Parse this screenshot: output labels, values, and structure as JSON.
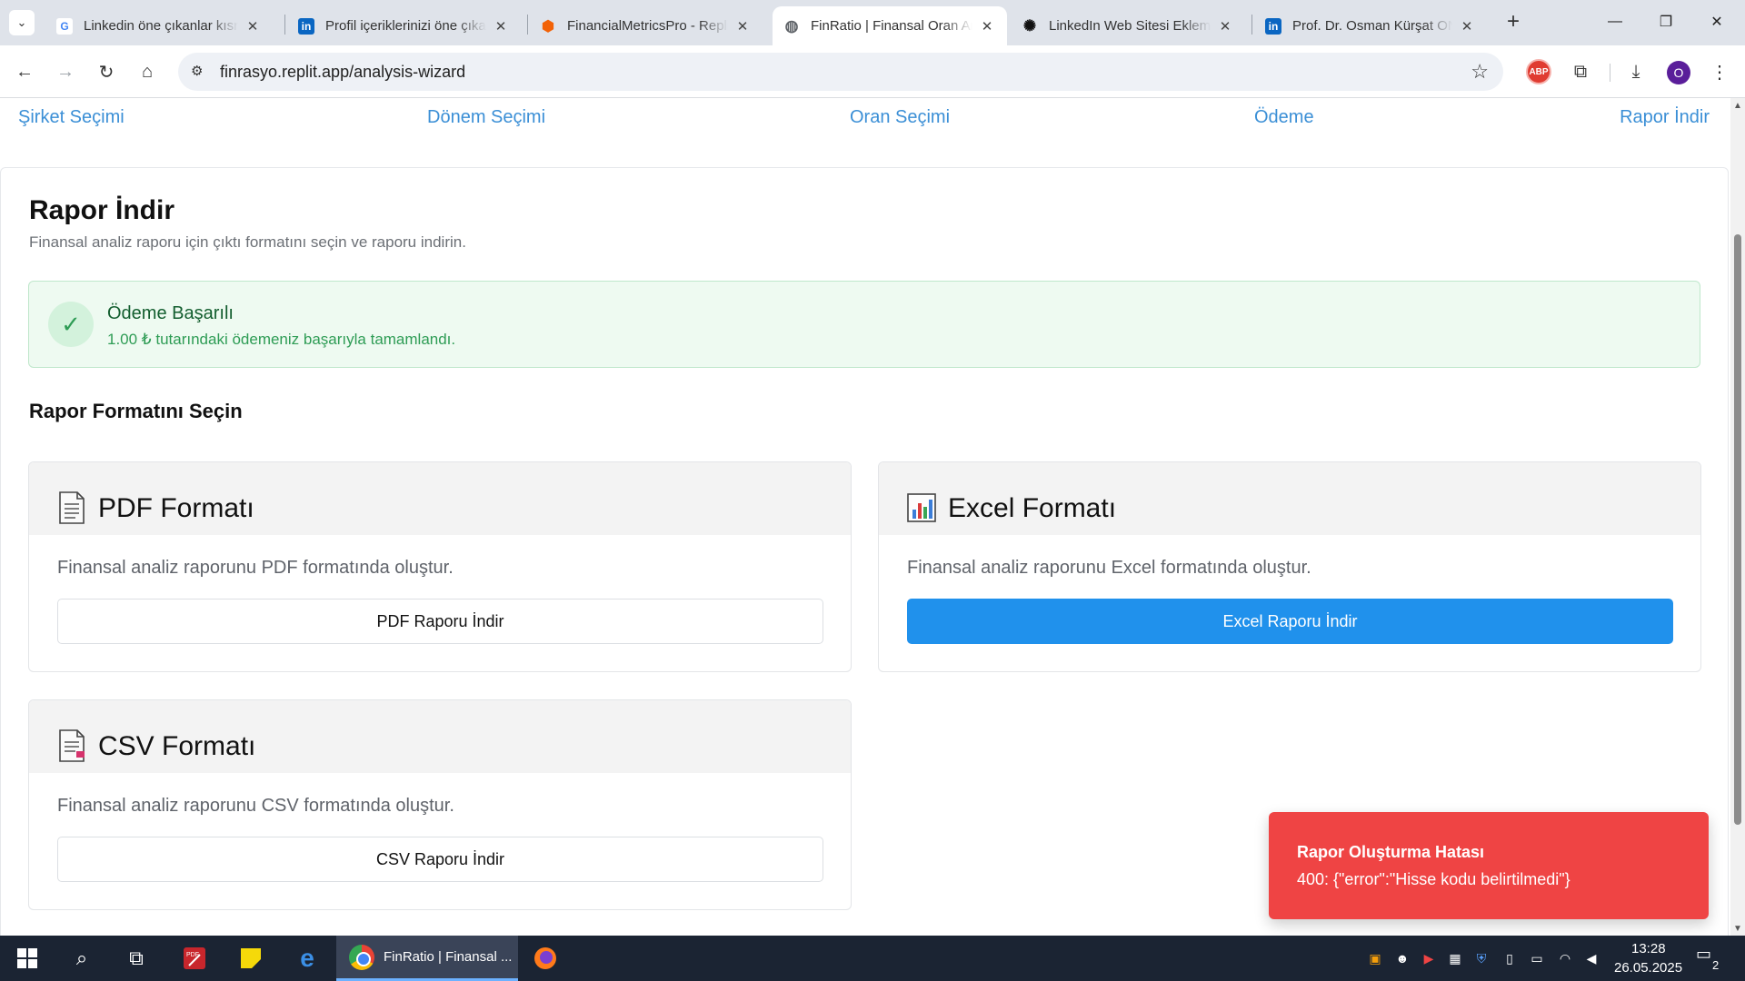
{
  "browser": {
    "tabs": [
      {
        "title": "Linkedin öne çıkanlar kısmı",
        "favicon": "google-icon",
        "color": "#4285f4",
        "glyph": "G"
      },
      {
        "title": "Profil içeriklerinizi öne çıkarın",
        "favicon": "linkedin-icon",
        "color": "#0a66c2",
        "glyph": "in"
      },
      {
        "title": "FinancialMetricsPro - Replit",
        "favicon": "replit-icon",
        "color": "#f26207",
        "glyph": "⬢"
      },
      {
        "title": "FinRatio | Finansal Oran Analizi",
        "favicon": "globe-icon",
        "color": "#5f6368",
        "glyph": "◍"
      },
      {
        "title": "LinkedIn Web Sitesi Ekleme",
        "favicon": "openai-icon",
        "color": "#111111",
        "glyph": "✺"
      },
      {
        "title": "Prof. Dr. Osman Kürşat ONAN",
        "favicon": "linkedin-icon",
        "color": "#0a66c2",
        "glyph": "in"
      }
    ],
    "url": "finrasyo.replit.app/analysis-wizard",
    "abp_label": "ABP",
    "avatar_letter": "O"
  },
  "wizard": {
    "steps": [
      "Şirket Seçimi",
      "Dönem Seçimi",
      "Oran Seçimi",
      "Ödeme",
      "Rapor İndir"
    ]
  },
  "page": {
    "title": "Rapor İndir",
    "subtitle": "Finansal analiz raporu için çıktı formatını seçin ve raporu indirin.",
    "success_title": "Ödeme Başarılı",
    "success_message": "1.00 ₺ tutarındaki ödemeniz başarıyla tamamlandı.",
    "section_title": "Rapor Formatını Seçin",
    "formats": {
      "pdf": {
        "title": "PDF Formatı",
        "description": "Finansal analiz raporunu PDF formatında oluştur.",
        "button": "PDF Raporu İndir"
      },
      "excel": {
        "title": "Excel Formatı",
        "description": "Finansal analiz raporunu Excel formatında oluştur.",
        "button": "Excel Raporu İndir"
      },
      "csv": {
        "title": "CSV Formatı",
        "description": "Finansal analiz raporunu CSV formatında oluştur.",
        "button": "CSV Raporu İndir"
      }
    },
    "accent_color": "#2091ec",
    "success_color": "#2e9c55"
  },
  "toast": {
    "title": "Rapor Oluşturma Hatası",
    "message": "400: {\"error\":\"Hisse kodu belirtilmedi\"}",
    "color": "#ef4444"
  },
  "taskbar": {
    "active_app_label": "FinRatio | Finansal ...",
    "time": "13:28",
    "date": "26.05.2025",
    "notification_count": "2"
  }
}
